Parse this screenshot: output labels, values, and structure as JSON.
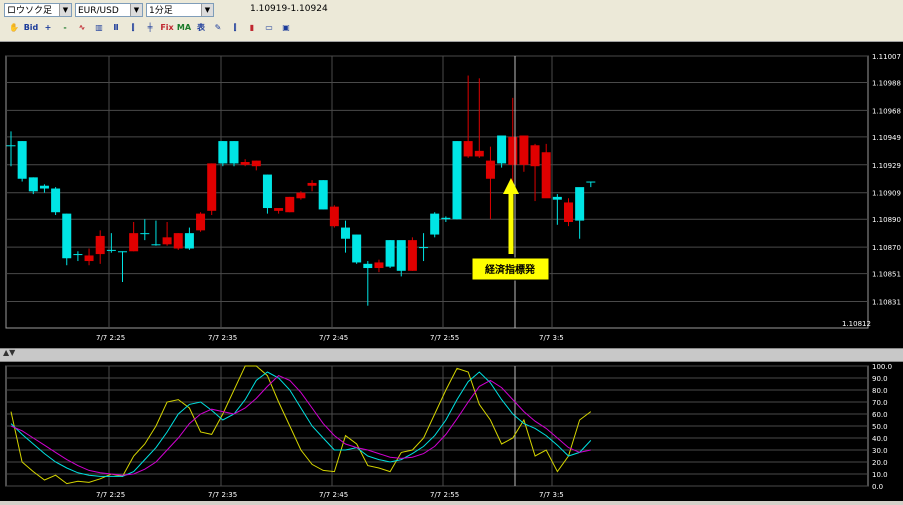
{
  "toolbar": {
    "chart_type": "ロウソク足",
    "symbol": "EUR/USD",
    "timeframe": "1分足",
    "price_range": "1.10919-1.10924",
    "icons": [
      {
        "name": "hand-icon",
        "glyph": "✋"
      },
      {
        "name": "bid-ask-icon",
        "glyph": "Bid"
      },
      {
        "name": "zoom-in-icon",
        "glyph": "+"
      },
      {
        "name": "zoom-out-icon",
        "glyph": "-"
      },
      {
        "name": "line-tool-icon",
        "glyph": "∿"
      },
      {
        "name": "bar-chart-icon",
        "glyph": "▥"
      },
      {
        "name": "period-icon",
        "glyph": "Ⅱ"
      },
      {
        "name": "candlestick-icon",
        "glyph": "⫿"
      },
      {
        "name": "stroke-icon",
        "glyph": "╪"
      },
      {
        "name": "fix-icon",
        "glyph": "Fix"
      },
      {
        "name": "ma-fix-icon",
        "glyph": "MA"
      },
      {
        "name": "hyo-fix-icon",
        "glyph": "表"
      },
      {
        "name": "draw-icon",
        "glyph": "✎"
      },
      {
        "name": "indicator-icon",
        "glyph": "⫿"
      },
      {
        "name": "bars-icon",
        "glyph": "▮"
      },
      {
        "name": "film-icon",
        "glyph": "▭"
      },
      {
        "name": "save-icon",
        "glyph": "▣"
      }
    ]
  },
  "annotation": {
    "label": "経済指標発"
  },
  "chart_data": [
    {
      "type": "candlestick",
      "symbol": "EUR/USD",
      "y_ticks": [
        "1.11007",
        "1.10988",
        "1.10968",
        "1.10949",
        "1.10929",
        "1.10909",
        "1.10890",
        "1.10870",
        "1.10851",
        "1.10831"
      ],
      "ylim": [
        1.10812,
        1.11007
      ],
      "bottom_label": "1.10812",
      "x_ticks": [
        "7/7 2:25",
        "7/7 2:35",
        "7/7 2:45",
        "7/7 2:55",
        "7/7 3:5"
      ],
      "candles": [
        {
          "o": 1.10943,
          "h": 1.10953,
          "l": 1.10928,
          "c": 1.10943
        },
        {
          "o": 1.10919,
          "h": 1.10946,
          "l": 1.10917,
          "c": 1.10946
        },
        {
          "o": 1.1091,
          "h": 1.1092,
          "l": 1.10908,
          "c": 1.1092
        },
        {
          "o": 1.10912,
          "h": 1.10915,
          "l": 1.10909,
          "c": 1.10914
        },
        {
          "o": 1.10895,
          "h": 1.10913,
          "l": 1.10893,
          "c": 1.10912
        },
        {
          "o": 1.10862,
          "h": 1.10894,
          "l": 1.10857,
          "c": 1.10894
        },
        {
          "o": 1.10865,
          "h": 1.10867,
          "l": 1.1086,
          "c": 1.10865
        },
        {
          "o": 1.10864,
          "h": 1.10869,
          "l": 1.10857,
          "c": 1.1086
        },
        {
          "o": 1.10878,
          "h": 1.10882,
          "l": 1.10858,
          "c": 1.10865
        },
        {
          "o": 1.10868,
          "h": 1.1088,
          "l": 1.10866,
          "c": 1.10868
        },
        {
          "o": 1.10867,
          "h": 1.10867,
          "l": 1.10845,
          "c": 1.10867
        },
        {
          "o": 1.1088,
          "h": 1.10888,
          "l": 1.10867,
          "c": 1.10867
        },
        {
          "o": 1.1088,
          "h": 1.1089,
          "l": 1.10875,
          "c": 1.1088
        },
        {
          "o": 1.10872,
          "h": 1.10889,
          "l": 1.10871,
          "c": 1.10872
        },
        {
          "o": 1.10877,
          "h": 1.10888,
          "l": 1.10871,
          "c": 1.10872
        },
        {
          "o": 1.1088,
          "h": 1.1088,
          "l": 1.10868,
          "c": 1.10869
        },
        {
          "o": 1.10869,
          "h": 1.10884,
          "l": 1.10868,
          "c": 1.1088
        },
        {
          "o": 1.10894,
          "h": 1.10895,
          "l": 1.10881,
          "c": 1.10882
        },
        {
          "o": 1.1093,
          "h": 1.1093,
          "l": 1.10893,
          "c": 1.10896
        },
        {
          "o": 1.1093,
          "h": 1.10946,
          "l": 1.10928,
          "c": 1.10946
        },
        {
          "o": 1.1093,
          "h": 1.10946,
          "l": 1.10928,
          "c": 1.10946
        },
        {
          "o": 1.10931,
          "h": 1.10933,
          "l": 1.10928,
          "c": 1.10929
        },
        {
          "o": 1.10932,
          "h": 1.10932,
          "l": 1.10925,
          "c": 1.10928
        },
        {
          "o": 1.10898,
          "h": 1.10922,
          "l": 1.10894,
          "c": 1.10922
        },
        {
          "o": 1.10898,
          "h": 1.10897,
          "l": 1.10894,
          "c": 1.10896
        },
        {
          "o": 1.10906,
          "h": 1.10906,
          "l": 1.10895,
          "c": 1.10895
        },
        {
          "o": 1.10909,
          "h": 1.1091,
          "l": 1.10904,
          "c": 1.10905
        },
        {
          "o": 1.10916,
          "h": 1.10918,
          "l": 1.1091,
          "c": 1.10914
        },
        {
          "o": 1.10897,
          "h": 1.10918,
          "l": 1.10897,
          "c": 1.10918
        },
        {
          "o": 1.10899,
          "h": 1.109,
          "l": 1.10884,
          "c": 1.10885
        },
        {
          "o": 1.10876,
          "h": 1.10889,
          "l": 1.10866,
          "c": 1.10884
        },
        {
          "o": 1.10859,
          "h": 1.10879,
          "l": 1.10858,
          "c": 1.10879
        },
        {
          "o": 1.10855,
          "h": 1.1086,
          "l": 1.10828,
          "c": 1.10858
        },
        {
          "o": 1.10859,
          "h": 1.10861,
          "l": 1.10852,
          "c": 1.10855
        },
        {
          "o": 1.10856,
          "h": 1.10875,
          "l": 1.10855,
          "c": 1.10875
        },
        {
          "o": 1.10853,
          "h": 1.10873,
          "l": 1.10849,
          "c": 1.10875
        },
        {
          "o": 1.10875,
          "h": 1.10877,
          "l": 1.10853,
          "c": 1.10853
        },
        {
          "o": 1.1087,
          "h": 1.1088,
          "l": 1.1086,
          "c": 1.1087
        },
        {
          "o": 1.10879,
          "h": 1.10895,
          "l": 1.10877,
          "c": 1.10894
        },
        {
          "o": 1.1089,
          "h": 1.10892,
          "l": 1.10888,
          "c": 1.10891
        },
        {
          "o": 1.1089,
          "h": 1.10946,
          "l": 1.1089,
          "c": 1.10946
        },
        {
          "o": 1.10946,
          "h": 1.10993,
          "l": 1.10934,
          "c": 1.10935
        },
        {
          "o": 1.10939,
          "h": 1.10991,
          "l": 1.10934,
          "c": 1.10935
        },
        {
          "o": 1.10932,
          "h": 1.10942,
          "l": 1.1089,
          "c": 1.10919
        },
        {
          "o": 1.1093,
          "h": 1.1095,
          "l": 1.10927,
          "c": 1.1095
        },
        {
          "o": 1.10949,
          "h": 1.10977,
          "l": 1.10914,
          "c": 1.10929
        },
        {
          "o": 1.1095,
          "h": 1.1095,
          "l": 1.10924,
          "c": 1.10929
        },
        {
          "o": 1.10943,
          "h": 1.10944,
          "l": 1.10903,
          "c": 1.10928
        },
        {
          "o": 1.10938,
          "h": 1.10944,
          "l": 1.10906,
          "c": 1.10905
        },
        {
          "o": 1.10904,
          "h": 1.10908,
          "l": 1.10886,
          "c": 1.10906
        },
        {
          "o": 1.10902,
          "h": 1.10905,
          "l": 1.10885,
          "c": 1.10888
        },
        {
          "o": 1.10889,
          "h": 1.10889,
          "l": 1.10876,
          "c": 1.10913
        },
        {
          "o": 1.10917,
          "h": 1.10917,
          "l": 1.10913,
          "c": 1.10917
        }
      ]
    },
    {
      "type": "line",
      "y_ticks": [
        "100.0",
        "90.0",
        "80.0",
        "70.0",
        "60.0",
        "50.0",
        "40.0",
        "30.0",
        "20.0",
        "10.0",
        "0.0"
      ],
      "ylim": [
        0,
        100
      ],
      "x_ticks": [
        "7/7 2:25",
        "7/7 2:35",
        "7/7 2:45",
        "7/7 2:55",
        "7/7 3:5"
      ],
      "series": [
        {
          "color": "#d4d400",
          "values": [
            62,
            20,
            12,
            5,
            9,
            2,
            4,
            3,
            6,
            10,
            8,
            25,
            35,
            50,
            70,
            72,
            65,
            45,
            43,
            60,
            80,
            100,
            100,
            92,
            70,
            50,
            30,
            18,
            13,
            12,
            42,
            35,
            17,
            15,
            12,
            28,
            30,
            40,
            60,
            80,
            98,
            95,
            68,
            55,
            35,
            40,
            55,
            25,
            30,
            12,
            25,
            55,
            62
          ]
        },
        {
          "color": "#00e0e0",
          "values": [
            52,
            43,
            35,
            27,
            20,
            15,
            11,
            9,
            8,
            8,
            8,
            12,
            22,
            32,
            45,
            60,
            68,
            70,
            63,
            55,
            60,
            72,
            88,
            95,
            90,
            80,
            65,
            50,
            40,
            30,
            30,
            32,
            25,
            22,
            20,
            22,
            27,
            33,
            42,
            55,
            72,
            87,
            95,
            86,
            72,
            60,
            52,
            48,
            42,
            34,
            25,
            28,
            38
          ]
        },
        {
          "color": "#d000d0",
          "values": [
            50,
            46,
            40,
            34,
            28,
            22,
            17,
            13,
            11,
            10,
            9,
            10,
            14,
            20,
            30,
            40,
            52,
            60,
            64,
            62,
            60,
            65,
            73,
            83,
            92,
            88,
            78,
            65,
            52,
            42,
            35,
            32,
            30,
            27,
            24,
            23,
            24,
            27,
            33,
            43,
            56,
            70,
            83,
            88,
            82,
            72,
            62,
            54,
            48,
            40,
            32,
            28,
            30
          ]
        }
      ]
    }
  ]
}
